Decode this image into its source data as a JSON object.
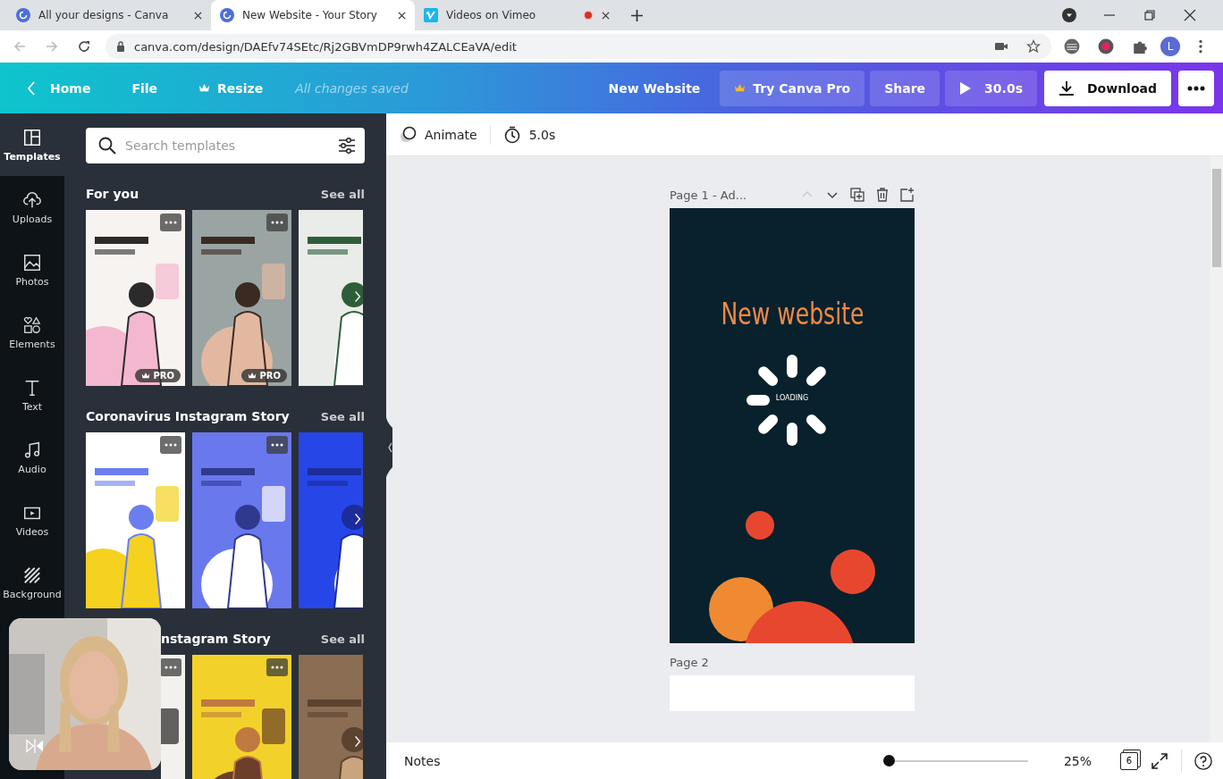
{
  "browser": {
    "tabs": [
      {
        "title": "All your designs - Canva",
        "selected": false,
        "recording": false
      },
      {
        "title": "New Website - Your Story",
        "selected": true,
        "recording": false
      },
      {
        "title": "Videos on Vimeo",
        "selected": false,
        "recording": true
      }
    ],
    "url": "canva.com/design/DAEfv74SEtc/Rj2GBVmDP9rwh4ZALCEaVA/edit",
    "profile_initial": "L"
  },
  "header": {
    "back": "Home",
    "menu": [
      "File",
      "Resize"
    ],
    "save_status": "All changes saved",
    "design_title": "New Website",
    "try_pro": "Try Canva Pro",
    "share": "Share",
    "duration": "30.0s",
    "download": "Download"
  },
  "rail": [
    {
      "label": "Templates",
      "selected": true
    },
    {
      "label": "Uploads",
      "selected": false
    },
    {
      "label": "Photos",
      "selected": false
    },
    {
      "label": "Elements",
      "selected": false
    },
    {
      "label": "Text",
      "selected": false
    },
    {
      "label": "Audio",
      "selected": false
    },
    {
      "label": "Videos",
      "selected": false
    },
    {
      "label": "Background",
      "selected": false
    }
  ],
  "search": {
    "placeholder": "Search templates"
  },
  "sections": [
    {
      "title": "For you",
      "see_all": "See all",
      "partly_hidden": false,
      "cards": [
        {
          "kind": "picture",
          "badge": "PRO"
        },
        {
          "kind": "picture",
          "badge": "PRO"
        },
        {
          "kind": "picture"
        }
      ]
    },
    {
      "title": "Coronavirus Instagram Story",
      "see_all": "See all",
      "partly_hidden": false,
      "cards": [
        {
          "kind": "picture"
        },
        {
          "kind": "picture"
        },
        {
          "kind": "picture"
        }
      ]
    },
    {
      "title": "nstagram Story",
      "see_all": "See all",
      "partly_hidden": true,
      "cards": [
        {
          "kind": "picture"
        },
        {
          "kind": "picture"
        },
        {
          "kind": "picture"
        }
      ]
    }
  ],
  "toolbar": {
    "animate": "Animate",
    "duration": "5.0s"
  },
  "pages": [
    {
      "label": "Page 1 - Ad...",
      "headline": "New website",
      "loader": "LOADING"
    },
    {
      "label": "Page 2"
    }
  ],
  "footer": {
    "notes": "Notes",
    "zoom": {
      "level": 0
    },
    "zoom_reading": "25%",
    "page_count": "6"
  }
}
